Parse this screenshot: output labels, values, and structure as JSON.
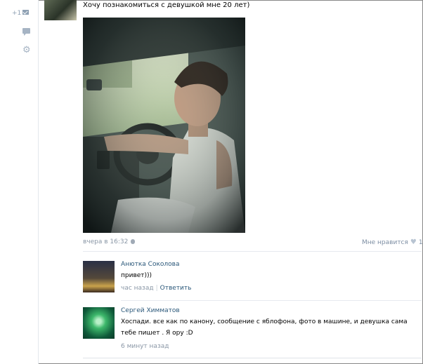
{
  "left": {
    "message_count": "+1"
  },
  "post": {
    "title": "Хочу познакомиться с девушкой мне 20 лет)",
    "date": "вчера в 16:32",
    "like_label": "Мне нравится",
    "like_count": "1"
  },
  "comments": [
    {
      "author": "Анютка Соколова",
      "text": "привет)))",
      "time": "час назад",
      "reply_label": "Ответить"
    },
    {
      "author": "Сергей Химматов",
      "text": "Хоспади. все как по канону, сообщение с яблофона, фото в машине, и девушка сама тебе пишет . Я ору :D",
      "time": "6 минут назад"
    }
  ]
}
